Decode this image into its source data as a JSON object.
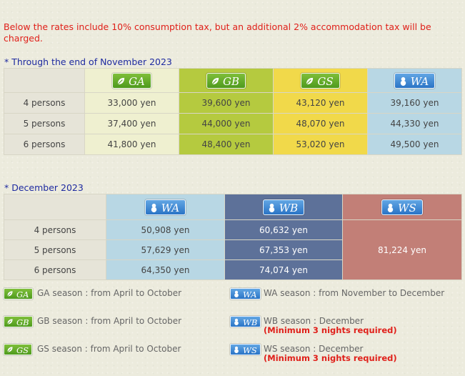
{
  "notice": "Below the rates include 10% consumption tax, but an additional 2% accommodation tax will be charged.",
  "colors": {
    "GA": "#eff0d0",
    "GB": "#b5ca3f",
    "GS": "#f1d94a",
    "WA": "#b8d7e4",
    "WB": "#5d7199",
    "WS": "#c27f77",
    "notice": "#e0201a",
    "heading": "#1e2aa0"
  },
  "table1": {
    "title": "* Through the end of November 2023",
    "headers": [
      "GA",
      "GB",
      "GS",
      "WA"
    ],
    "rows": [
      {
        "label": "4 persons",
        "values": [
          "33,000 yen",
          "39,600 yen",
          "43,120 yen",
          "39,160 yen"
        ]
      },
      {
        "label": "5 persons",
        "values": [
          "37,400 yen",
          "44,000 yen",
          "48,070 yen",
          "44,330 yen"
        ]
      },
      {
        "label": "6 persons",
        "values": [
          "41,800 yen",
          "48,400 yen",
          "53,020 yen",
          "49,500 yen"
        ]
      }
    ]
  },
  "table2": {
    "title": "* December 2023",
    "headers": [
      "WA",
      "WB",
      "WS"
    ],
    "rows": [
      {
        "label": "4 persons",
        "values": [
          "50,908 yen",
          "60,632 yen"
        ]
      },
      {
        "label": "5 persons",
        "values": [
          "57,629 yen",
          "67,353 yen"
        ]
      },
      {
        "label": "6 persons",
        "values": [
          "64,350 yen",
          "74,074 yen"
        ]
      }
    ],
    "ws_value": "81,224 yen"
  },
  "legend": [
    {
      "code": "GA",
      "icon": "leaf-icon",
      "text": "GA season : from April to October",
      "note": ""
    },
    {
      "code": "WA",
      "icon": "snowman-icon",
      "text": "WA season : from November to December",
      "note": ""
    },
    {
      "code": "GB",
      "icon": "leaf-icon",
      "text": "GB season : from April to October",
      "note": ""
    },
    {
      "code": "WB",
      "icon": "snowman-icon",
      "text": "WB season : December",
      "note": "(Minimum 3 nights required)"
    },
    {
      "code": "GS",
      "icon": "leaf-icon",
      "text": "GS season : from April to October",
      "note": ""
    },
    {
      "code": "WS",
      "icon": "snowman-icon",
      "text": "WS season : December",
      "note": "(Minimum 3 nights required)"
    }
  ]
}
